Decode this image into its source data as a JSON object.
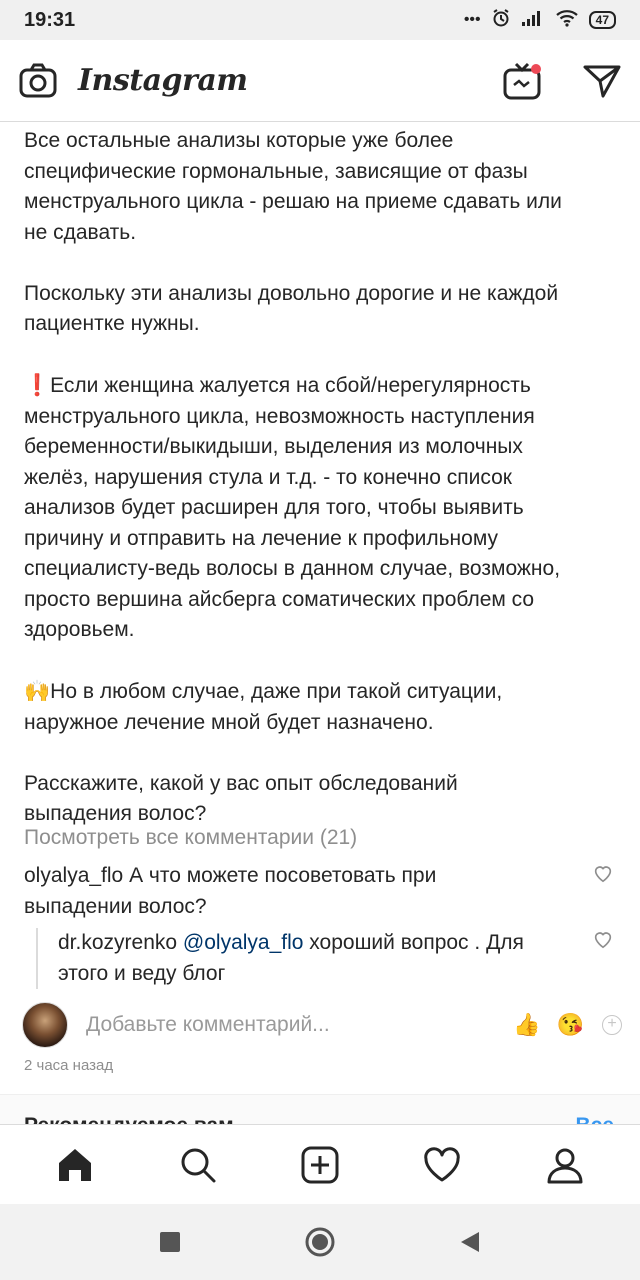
{
  "status_bar": {
    "time": "19:31",
    "dots": "•••",
    "battery": "47"
  },
  "header": {
    "logo": "Instagram"
  },
  "post": {
    "paragraphs": [
      "Все остальные анализы которые уже более\nспецифические гормональные, зависящие от фазы\nменструального цикла - решаю на приеме сдавать или\nне сдавать.",
      "Поскольку эти анализы довольно дорогие и не каждой\nпациентке нужны.",
      "Если женщина жалуется на сбой/нерегулярность\nменструального цикла, невозможность наступления\nбеременности/выкидыши, выделения из молочных\nжелёз, нарушения стула и т.д. - то конечно список\nанализов будет расширен для того, чтобы выявить\nпричину и отправить на лечение к профильному\nспециалисту-ведь волосы в данном случае, возможно,\nпросто вершина айсберга соматических проблем со\nздоровьем.",
      "Но в любом случае, даже при такой ситуации,\nнаружное лечение мной будет назначено.",
      "Расскажите, какой у вас опыт обследований\nвыпадения волос?"
    ],
    "emoji_exclamation": "❗",
    "emoji_hands": "🙌"
  },
  "comments": {
    "view_all": "Посмотреть все комментарии (21)",
    "items": [
      {
        "user": "olyalya_flo",
        "text": " А что можете посоветовать при\nвыпадении волос?"
      }
    ],
    "reply": {
      "user": "dr.kozyrenko",
      "mention": "@olyalya_flo",
      "text": " хороший вопрос . Для\nэтого и веду блог"
    }
  },
  "add_comment": {
    "placeholder": "Добавьте комментарий...",
    "emoji_1": "👍",
    "emoji_2": "😘",
    "plus": "+"
  },
  "timestamp": "2 часа назад",
  "suggestions": {
    "title": "Рекомендуемое вам",
    "see_all": "Все"
  },
  "bottom_nav": {
    "items": [
      "home-icon",
      "search-icon",
      "add-post-icon",
      "activity-heart-icon",
      "profile-icon"
    ]
  },
  "colors": {
    "text": "#262626",
    "muted": "#8e8e8e",
    "link": "#003569",
    "accent_blue": "#3897f0",
    "notify_red": "#ed4956"
  }
}
